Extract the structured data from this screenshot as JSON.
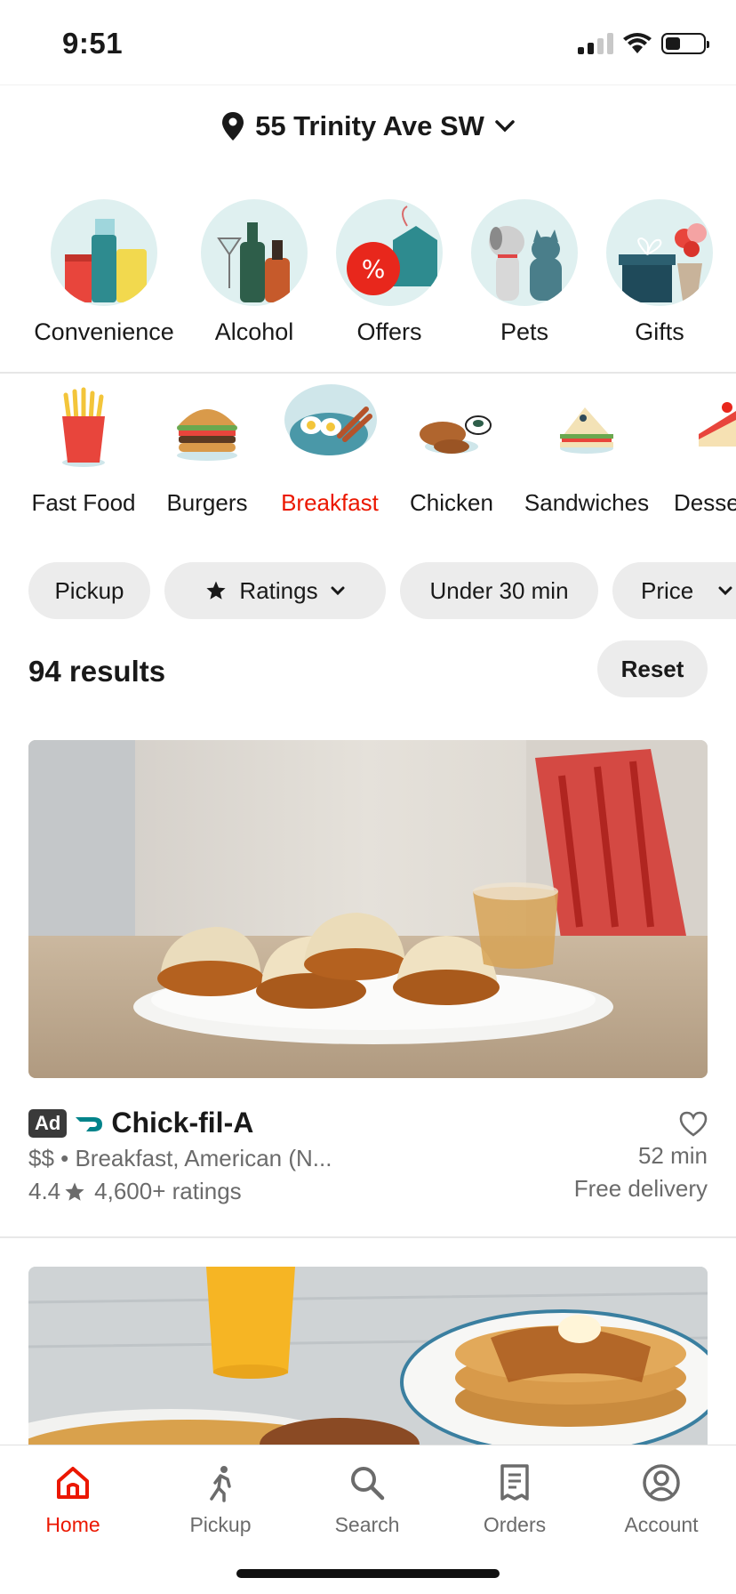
{
  "status_bar": {
    "time": "9:51"
  },
  "header": {
    "address": "55 Trinity Ave SW"
  },
  "verticals": [
    {
      "label": "Convenience",
      "icon": "convenience-icon"
    },
    {
      "label": "Alcohol",
      "icon": "alcohol-icon"
    },
    {
      "label": "Offers",
      "icon": "offers-icon"
    },
    {
      "label": "Pets",
      "icon": "pets-icon"
    },
    {
      "label": "Gifts",
      "icon": "gifts-icon"
    }
  ],
  "cuisines": [
    {
      "label": "Fast Food",
      "icon": "fries-icon"
    },
    {
      "label": "Burgers",
      "icon": "burger-icon"
    },
    {
      "label": "Breakfast",
      "icon": "breakfast-icon",
      "selected": true
    },
    {
      "label": "Chicken",
      "icon": "chicken-icon"
    },
    {
      "label": "Sandwiches",
      "icon": "sandwich-icon"
    },
    {
      "label": "Desse",
      "icon": "dessert-icon"
    }
  ],
  "filters": [
    {
      "label": "Pickup"
    },
    {
      "label": "Ratings",
      "icon": "star-icon",
      "dropdown": true
    },
    {
      "label": "Under 30 min"
    },
    {
      "label": "Price",
      "dropdown": true
    }
  ],
  "results": {
    "count_text": "94 results",
    "reset_label": "Reset"
  },
  "stores": [
    {
      "ad_label": "Ad",
      "name": "Chick-fil-A",
      "meta": "$$ • Breakfast, American (N...",
      "rating": "4.4",
      "ratings_text": "4,600+ ratings",
      "eta": "52 min",
      "delivery": "Free delivery"
    }
  ],
  "bottom_nav": [
    {
      "label": "Home",
      "icon": "home-icon",
      "active": true
    },
    {
      "label": "Pickup",
      "icon": "pickup-icon"
    },
    {
      "label": "Search",
      "icon": "search-icon"
    },
    {
      "label": "Orders",
      "icon": "orders-icon"
    },
    {
      "label": "Account",
      "icon": "account-icon"
    }
  ],
  "colors": {
    "accent": "#eb1700",
    "chip_bg": "#ececec",
    "teal": "#2e8b8f"
  }
}
